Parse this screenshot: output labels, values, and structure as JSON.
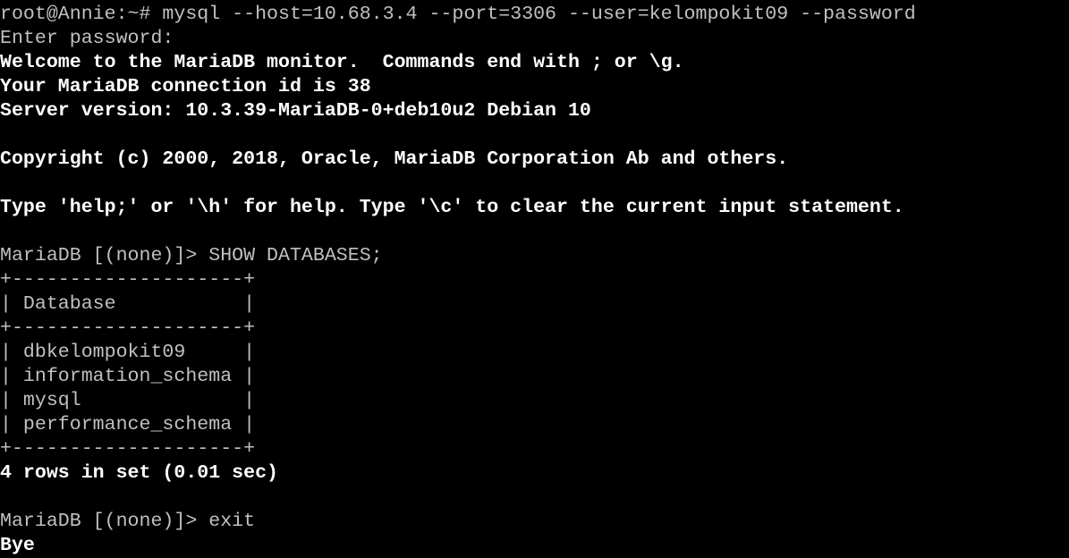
{
  "terminal": {
    "colors": {
      "background": "#000000",
      "text": "#c0c0c0",
      "bold_text": "#ffffff"
    },
    "lines": [
      {
        "text": "root@Annie:~# mysql --host=10.68.3.4 --port=3306 --user=kelompokit09 --password",
        "style": "normal"
      },
      {
        "text": "Enter password:",
        "style": "normal"
      },
      {
        "text": "Welcome to the MariaDB monitor.  Commands end with ; or \\g.",
        "style": "bold"
      },
      {
        "text": "Your MariaDB connection id is 38",
        "style": "bold"
      },
      {
        "text": "Server version: 10.3.39-MariaDB-0+deb10u2 Debian 10",
        "style": "bold"
      },
      {
        "text": "",
        "style": "normal"
      },
      {
        "text": "Copyright (c) 2000, 2018, Oracle, MariaDB Corporation Ab and others.",
        "style": "bold"
      },
      {
        "text": "",
        "style": "normal"
      },
      {
        "text": "Type 'help;' or '\\h' for help. Type '\\c' to clear the current input statement.",
        "style": "bold"
      },
      {
        "text": "",
        "style": "normal"
      },
      {
        "text": "MariaDB [(none)]> SHOW DATABASES;",
        "style": "normal"
      },
      {
        "text": "+--------------------+",
        "style": "normal"
      },
      {
        "text": "| Database           |",
        "style": "normal"
      },
      {
        "text": "+--------------------+",
        "style": "normal"
      },
      {
        "text": "| dbkelompokit09     |",
        "style": "normal"
      },
      {
        "text": "| information_schema |",
        "style": "normal"
      },
      {
        "text": "| mysql              |",
        "style": "normal"
      },
      {
        "text": "| performance_schema |",
        "style": "normal"
      },
      {
        "text": "+--------------------+",
        "style": "normal"
      },
      {
        "text": "4 rows in set (0.01 sec)",
        "style": "bold"
      },
      {
        "text": "",
        "style": "normal"
      },
      {
        "text": "MariaDB [(none)]> exit",
        "style": "normal"
      },
      {
        "text": "Bye",
        "style": "bold"
      }
    ]
  }
}
